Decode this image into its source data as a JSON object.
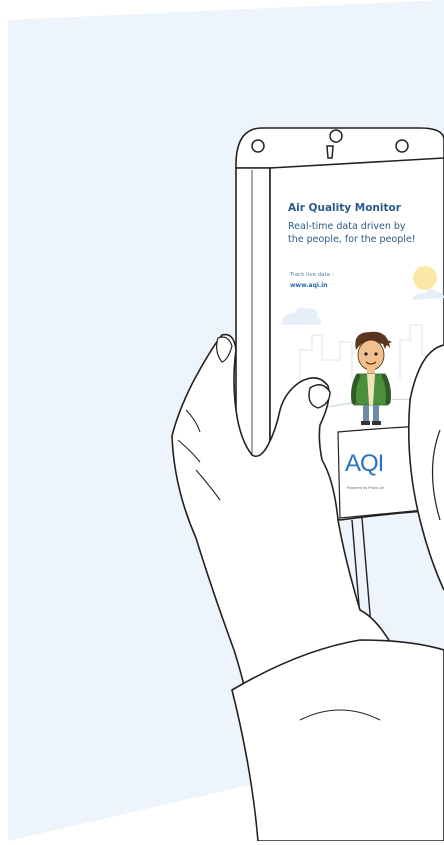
{
  "device": {
    "title": "Air Quality Monitor",
    "tagline_line1": "Real-time data driven by",
    "tagline_line2": "the people, for the people!",
    "track_label": "Track live data :",
    "url": "www.aqi.in",
    "logo_text": "AQI",
    "powered_by": "Powered by Prana Air"
  },
  "colors": {
    "background": "#eef4fb",
    "title_blue": "#2a5a88",
    "logo_blue": "#2a74c0",
    "sun_yellow": "#fde7a6",
    "jacket_green": "#4a8f3c"
  }
}
